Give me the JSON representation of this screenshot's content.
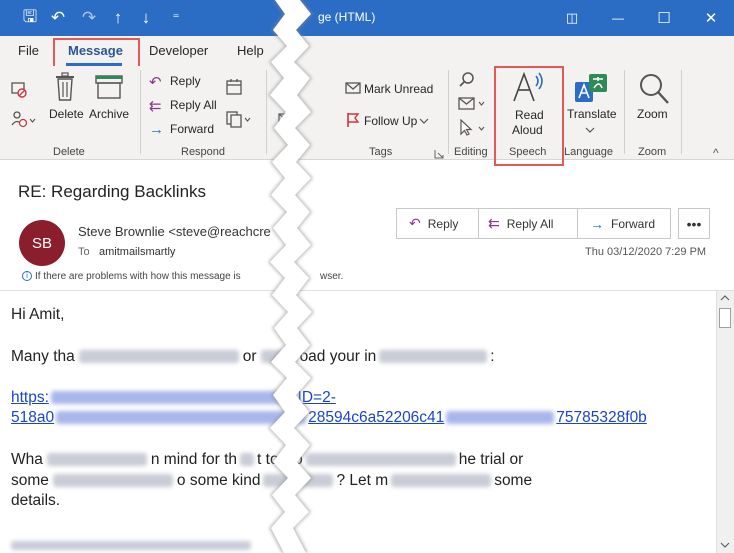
{
  "titlebar": {
    "window_title": "ge (HTML)",
    "qat": [
      "save-icon",
      "undo-icon",
      "redo-icon",
      "up-arrow-icon",
      "down-arrow-icon",
      "customize-icon"
    ],
    "controls": [
      "restore-ribbon-icon",
      "minimize-icon",
      "maximize-icon",
      "close-icon"
    ],
    "glyphs": {
      "save": "🖫",
      "undo": "↶",
      "redo": "↷",
      "up": "↑",
      "down": "↓",
      "customize": "⁼",
      "restore": "◫",
      "minimize": "—",
      "maximize": "☐",
      "close": "✕"
    }
  },
  "tabs": {
    "file": "File",
    "message": "Message",
    "developer": "Developer",
    "help": "Help"
  },
  "ribbon": {
    "delete_group": {
      "delete": "Delete",
      "archive": "Archive",
      "label": "Delete"
    },
    "respond_group": {
      "reply": "Reply",
      "reply_all": "Reply All",
      "forward": "Forward",
      "label": "Respond"
    },
    "tags_group": {
      "mark_unread": "Mark Unread",
      "follow_up": "Follow Up",
      "label": "Tags"
    },
    "editing_group": {
      "label": "Editing"
    },
    "speech_group": {
      "read_aloud_line1": "Read",
      "read_aloud_line2": "Aloud",
      "label": "Speech"
    },
    "language_group": {
      "translate": "Translate",
      "label": "Language"
    },
    "zoom_group": {
      "zoom": "Zoom",
      "label": "Zoom"
    },
    "collapse_glyph": "^"
  },
  "message": {
    "subject": "RE: Regarding Backlinks",
    "avatar_initials": "SB",
    "avatar_color": "#8b1e2d",
    "sender": "Steve Brownlie <steve@reachcre",
    "to_label": "To",
    "to_name": "amitmailsmartly",
    "info_text_a": "If there are problems with how this message is",
    "info_text_b": "wser.",
    "info_glyph": "i",
    "actions": {
      "reply": "Reply",
      "reply_all": "Reply All",
      "forward": "Forward",
      "more": "•••"
    },
    "action_glyphs": {
      "reply": "↶",
      "reply_all": "⇇",
      "forward": "→"
    },
    "timestamp": "Thu 03/12/2020 7:29 PM"
  },
  "body": {
    "greeting": "Hi Amit,",
    "line2_a": "Many tha",
    "line2_b": "or",
    "line2_c": "oad your in",
    "line2_d": ":",
    "link_line1_a": "https:",
    "link_line1_b": "eID=2-",
    "link_line2_a": "518a0",
    "link_line2_b": "28594c6a52206c41",
    "link_line2_c": "75785328f0b",
    "para3_line1_a": "Wha",
    "para3_line1_b": "n mind for th",
    "para3_line1_c": "t to wo",
    "para3_line1_d": "he trial or",
    "para3_line2_a": "some",
    "para3_line2_b": "o some kind",
    "para3_line2_c": "? Let m",
    "para3_line2_d": "some",
    "para3_line3": "details."
  },
  "colors": {
    "titlebar": "#2b6cc4",
    "ribbon_bg": "#f3f2f1",
    "highlight": "#e05a5a",
    "link": "#1a45c8",
    "accent_text": "#2b579a"
  }
}
